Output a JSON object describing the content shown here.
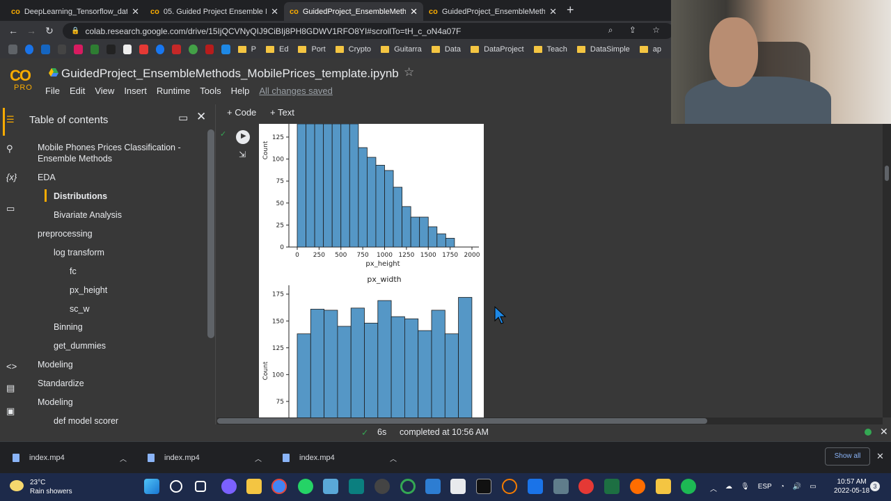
{
  "browser": {
    "tabs": [
      {
        "label": "DeepLearning_Tensorflow_datage",
        "icon": "colab-icon"
      },
      {
        "label": "05. Guided Project Ensemble Me",
        "icon": "colab-icon"
      },
      {
        "label": "GuidedProject_EnsembleMethod",
        "icon": "colab-icon"
      },
      {
        "label": "GuidedProject_EnsembleMethod",
        "icon": "colab-icon"
      }
    ],
    "new_tab": "+",
    "url": "colab.research.google.com/drive/15IjQCVNyQIJ9CiBIj8PH8GDWV1RFO8YI#scrollTo=tH_c_oN4a07F",
    "bookmarks": [
      "P",
      "Ed",
      "Port",
      "Crypto",
      "Guitarra",
      "Data",
      "DataProject",
      "Teach",
      "DataSimple",
      "ap"
    ]
  },
  "colab": {
    "logo": "CO",
    "pro": "PRO",
    "title": "GuidedProject_EnsembleMethods_MobilePrices_template.ipynb",
    "menu": [
      "File",
      "Edit",
      "View",
      "Insert",
      "Runtime",
      "Tools",
      "Help"
    ],
    "saved": "All changes saved",
    "add_code": "+ Code",
    "add_text": "+ Text"
  },
  "toc": {
    "heading": "Table of contents",
    "items": [
      {
        "label": "Mobile Phones Prices Classification -",
        "level": 0
      },
      {
        "label": "Ensemble Methods",
        "level": 0
      },
      {
        "label": "EDA",
        "level": 0
      },
      {
        "label": "Distributions",
        "level": 1,
        "selected": true
      },
      {
        "label": "Bivariate Analysis",
        "level": 1
      },
      {
        "label": "preprocessing",
        "level": 0
      },
      {
        "label": "log transform",
        "level": 1
      },
      {
        "label": "fc",
        "level": 2
      },
      {
        "label": "px_height",
        "level": 2
      },
      {
        "label": "sc_w",
        "level": 2
      },
      {
        "label": "Binning",
        "level": 1
      },
      {
        "label": "get_dummies",
        "level": 1
      },
      {
        "label": "Modeling",
        "level": 0
      },
      {
        "label": "Standardize",
        "level": 0
      },
      {
        "label": "Modeling",
        "level": 0
      },
      {
        "label": "def model scorer",
        "level": 1
      }
    ]
  },
  "chart_data": [
    {
      "type": "bar",
      "title": "",
      "xlabel": "px_height",
      "ylabel": "Count",
      "x_ticks": [
        "0",
        "250",
        "500",
        "750",
        "1000",
        "1250",
        "1500",
        "1750",
        "2000"
      ],
      "y_ticks": [
        "0",
        "25",
        "50",
        "75",
        "100",
        "125"
      ],
      "ylim": [
        0,
        140
      ],
      "bin_starts": [
        0,
        100,
        200,
        300,
        400,
        500,
        600,
        700,
        800,
        900,
        1000,
        1100,
        1200,
        1300,
        1400,
        1500,
        1600,
        1700,
        1800,
        1900
      ],
      "values": [
        140,
        140,
        140,
        140,
        140,
        140,
        140,
        113,
        102,
        93,
        87,
        68,
        46,
        34,
        34,
        23,
        15,
        10,
        0,
        0
      ]
    },
    {
      "type": "bar",
      "title": "px_width",
      "xlabel": "",
      "ylabel": "Count",
      "y_ticks": [
        "75",
        "100",
        "125",
        "150",
        "175"
      ],
      "ylim": [
        60,
        180
      ],
      "values": [
        138,
        161,
        160,
        145,
        162,
        148,
        169,
        154,
        152,
        141,
        160,
        138,
        172
      ]
    }
  ],
  "status": {
    "duration": "6s",
    "text": "completed at 10:56 AM"
  },
  "downloads": {
    "items": [
      "index.mp4",
      "index.mp4",
      "index.mp4"
    ],
    "show_all": "Show all"
  },
  "taskbar": {
    "temp": "23°C",
    "weather": "Rain showers",
    "lang": "ESP",
    "time": "10:57 AM",
    "date": "2022-05-18",
    "notif": "3"
  }
}
